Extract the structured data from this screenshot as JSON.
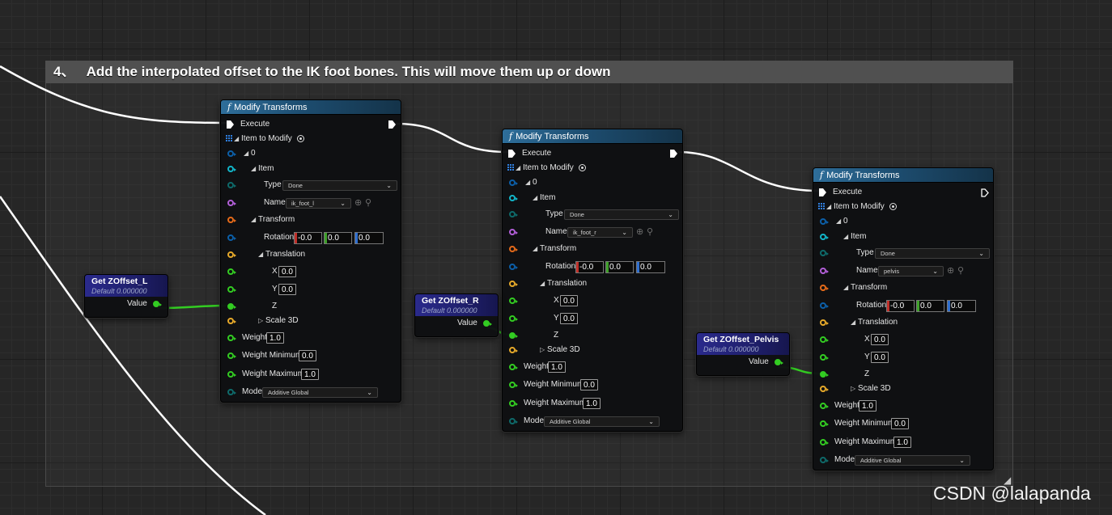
{
  "comment": {
    "number": "4、",
    "text": "Add the interpolated offset to the IK foot bones. This will move them up or down"
  },
  "node_title": "Modify Transforms",
  "labels": {
    "execute": "Execute",
    "item_to_modify": "Item to Modify",
    "index0": "0",
    "item": "Item",
    "type": "Type",
    "name": "Name",
    "transform": "Transform",
    "rotation": "Rotation",
    "translation": "Translation",
    "x": "X",
    "y": "Y",
    "z": "Z",
    "scale3d": "Scale 3D",
    "weight": "Weight",
    "weight_min": "Weight Minimum",
    "weight_max": "Weight Maximum",
    "mode": "Mode"
  },
  "nodes": [
    {
      "type_value": "Done",
      "name_value": "ik_foot_l",
      "rotation": [
        "-0.0",
        "0.0",
        "0.0"
      ],
      "translation_x": "0.0",
      "translation_y": "0.0",
      "weight": "1.0",
      "weight_min": "0.0",
      "weight_max": "1.0",
      "mode": "Additive Global"
    },
    {
      "type_value": "Done",
      "name_value": "ik_foot_r",
      "rotation": [
        "-0.0",
        "0.0",
        "0.0"
      ],
      "translation_x": "0.0",
      "translation_y": "0.0",
      "weight": "1.0",
      "weight_min": "0.0",
      "weight_max": "1.0",
      "mode": "Additive Global"
    },
    {
      "type_value": "Done",
      "name_value": "pelvis",
      "rotation": [
        "-0.0",
        "0.0",
        "0.0"
      ],
      "translation_x": "0.0",
      "translation_y": "0.0",
      "weight": "1.0",
      "weight_min": "0.0",
      "weight_max": "1.0",
      "mode": "Additive Global"
    }
  ],
  "getters": [
    {
      "title": "Get ZOffset_L",
      "default": "Default 0.000000",
      "value_label": "Value"
    },
    {
      "title": "Get ZOffset_R",
      "default": "Default 0.000000",
      "value_label": "Value"
    },
    {
      "title": "Get ZOffset_Pelvis",
      "default": "Default 0.000000",
      "value_label": "Value"
    }
  ],
  "watermark": "CSDN @lalapanda",
  "colors": {
    "exec": "#ffffff",
    "struct_blue": "#0c5fa8",
    "cyan": "#12b5c8",
    "teal_dim": "#0e6a6a",
    "name_purple": "#b25fd8",
    "transform_orange": "#e46a1a",
    "translation_gold": "#e6a92a",
    "float_green": "#33cc22",
    "wire_float": "#33cc22",
    "wire_exec": "#ffffff"
  },
  "icons": [
    "function-icon",
    "exec-pin-icon",
    "array-grid-icon",
    "add-pin-icon",
    "reset-arrow-icon",
    "search-icon",
    "expand-triangle-icon",
    "collapse-triangle-icon",
    "dropdown-chevron-icon",
    "resize-grip-icon"
  ]
}
